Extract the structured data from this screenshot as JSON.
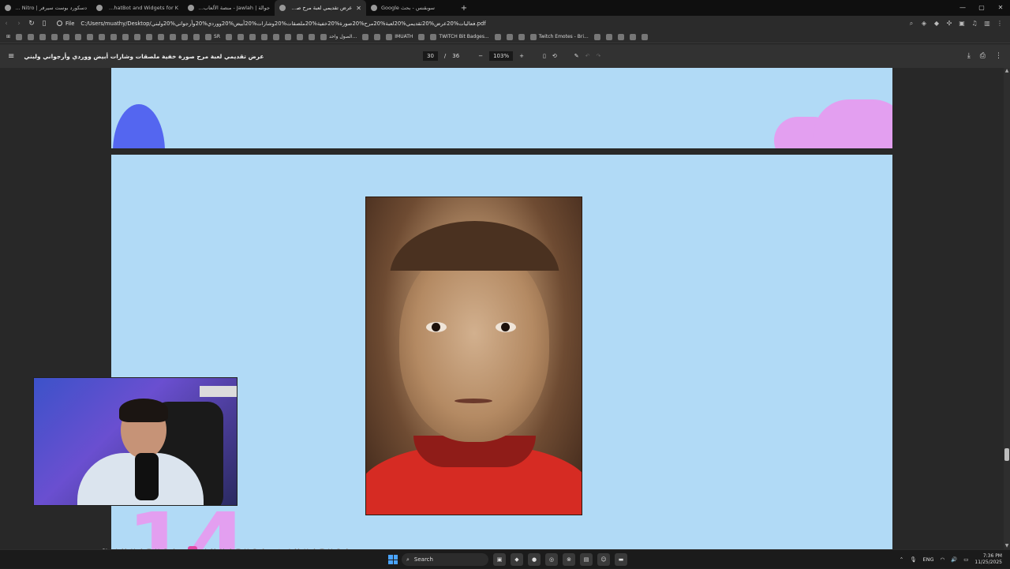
{
  "tabs": [
    {
      "title": "دسكورد بوست سيرفر | Discord Nitro",
      "active": false
    },
    {
      "title": "The best ChatBot and Widgets for K",
      "active": false
    },
    {
      "title": "جوالة | Jawlah - منصة الألعاب التفاعلية",
      "active": false
    },
    {
      "title": "عرض تقديمي لعبة مرح صورة خفية",
      "active": true
    },
    {
      "title": "سوبقنس - بحث Google",
      "active": false
    }
  ],
  "tab_close": "✕",
  "new_tab": "+",
  "window_controls": [
    "—",
    "▢",
    "✕"
  ],
  "address": {
    "file_label": "File",
    "url": "C:/Users/muathy/Desktop/فعاليات%20عرض%20تقديمي%20لعبة%20مرح%20صورة%20خفية%20ملصقات%20وشارات%20أبيض%20ووردي%20وأرجواني%20ولبني.pdf"
  },
  "bookmarks": [
    {
      "label": "SR"
    },
    {
      "label": "الصول واحد..."
    },
    {
      "label": "IMUATH"
    },
    {
      "label": "TWITCH Bit Badges..."
    },
    {
      "label": "Twitch Emotes - Bri..."
    }
  ],
  "pdf": {
    "title": "عرض تقديمي لعبة مرح صورة خفية ملصقات وشارات أبيض ووردي وأرجواني ولبني",
    "page_current": "30",
    "page_sep": "/",
    "page_total": "36",
    "zoom": "103%",
    "zoom_out": "−",
    "zoom_in": "+"
  },
  "page_number_text": "14",
  "stream_overlay": {
    "handle_1": "IMUATH94",
    "handle_2": "IMUATH94",
    "handle_3": "IMUATH94"
  },
  "taskbar": {
    "search_label": "Search",
    "lang": "ENG",
    "time": "7:36 PM",
    "date": "11/25/2025"
  },
  "colors": {
    "page_bg": "#b1daf6",
    "accent_pink": "#e39ff0",
    "accent_blue": "#5466f0"
  }
}
